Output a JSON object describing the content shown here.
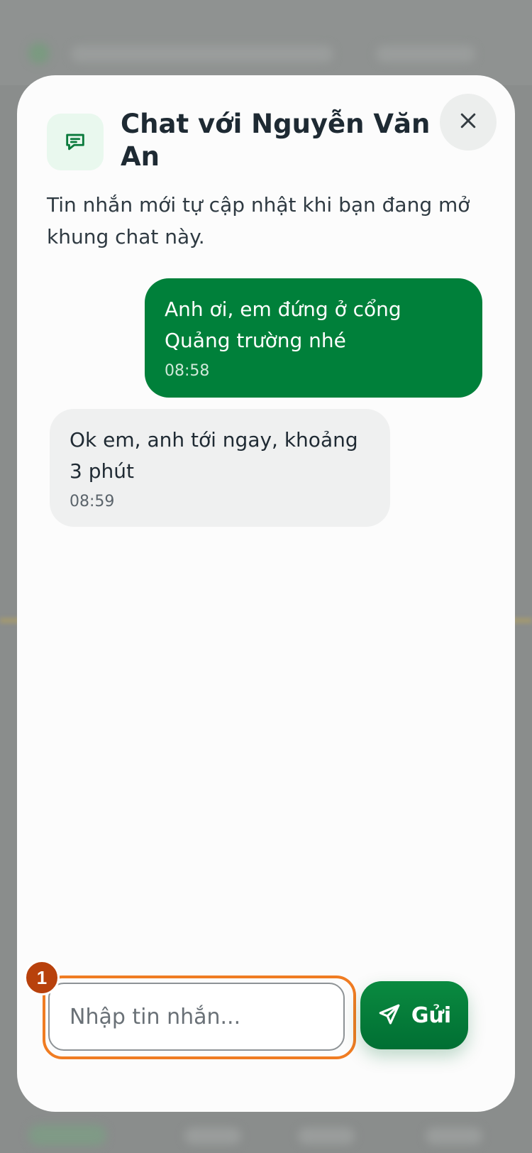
{
  "chat": {
    "title": "Chat với Nguyễn Văn An",
    "subtitle": "Tin nhắn mới tự cập nhật khi bạn đang mở khung chat này.",
    "messages": [
      {
        "direction": "outgoing",
        "text": "Anh ơi, em đứng ở cổng Quảng trường nhé",
        "time": "08:58"
      },
      {
        "direction": "incoming",
        "text": "Ok em, anh tới ngay, khoảng 3 phút",
        "time": "08:59"
      }
    ],
    "input": {
      "placeholder": "Nhập tin nhắn...",
      "value": ""
    },
    "send_label": "Gửi",
    "badge": "1"
  },
  "icons": {
    "header": "chat-bubble-icon",
    "close": "close-icon",
    "send": "send-icon"
  },
  "colors": {
    "primary": "#00803a",
    "outgoing_bubble": "#00803a",
    "incoming_bubble": "#eff0f0",
    "highlight": "#f07c22",
    "badge": "#b8410c"
  }
}
